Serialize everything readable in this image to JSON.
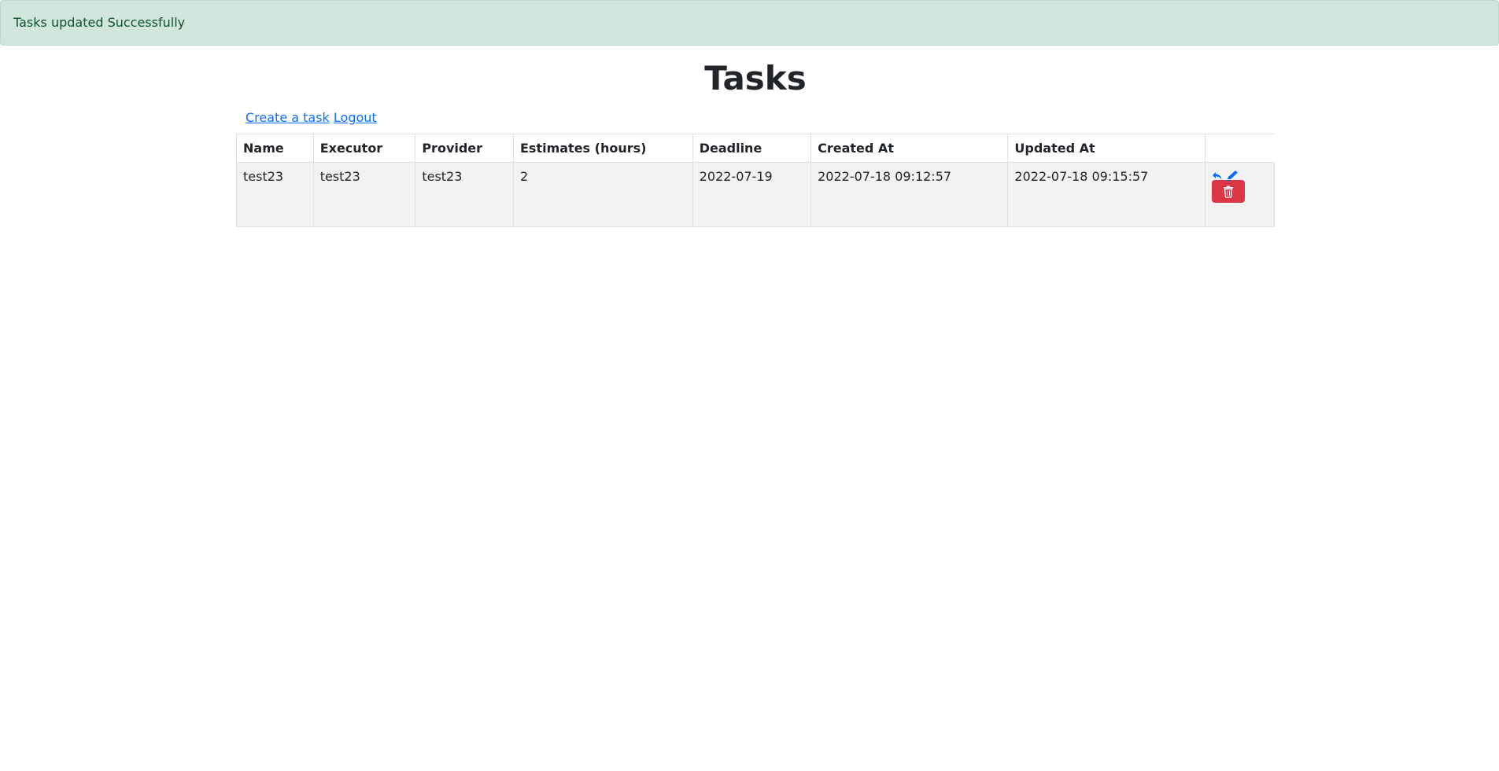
{
  "alert": {
    "message": "Tasks updated Successfully"
  },
  "page": {
    "title": "Tasks"
  },
  "links": {
    "create": "Create a task",
    "logout": "Logout"
  },
  "table": {
    "headers": [
      "Name",
      "Executor",
      "Provider",
      "Estimates (hours)",
      "Deadline",
      "Created At",
      "Updated At",
      ""
    ],
    "rows": [
      {
        "name": "test23",
        "executor": "test23",
        "provider": "test23",
        "estimates": "2",
        "deadline": "2022-07-19",
        "created_at": "2022-07-18 09:12:57",
        "updated_at": "2022-07-18 09:15:57",
        "actions": {
          "icons": [
            "undo-icon",
            "edit-icon",
            "trash-icon"
          ]
        }
      }
    ]
  },
  "colors": {
    "alert_bg": "#d1e7dd",
    "alert_text": "#0f5132",
    "link": "#0d6efd",
    "danger": "#dc3545",
    "row_bg": "#f2f2f2"
  }
}
